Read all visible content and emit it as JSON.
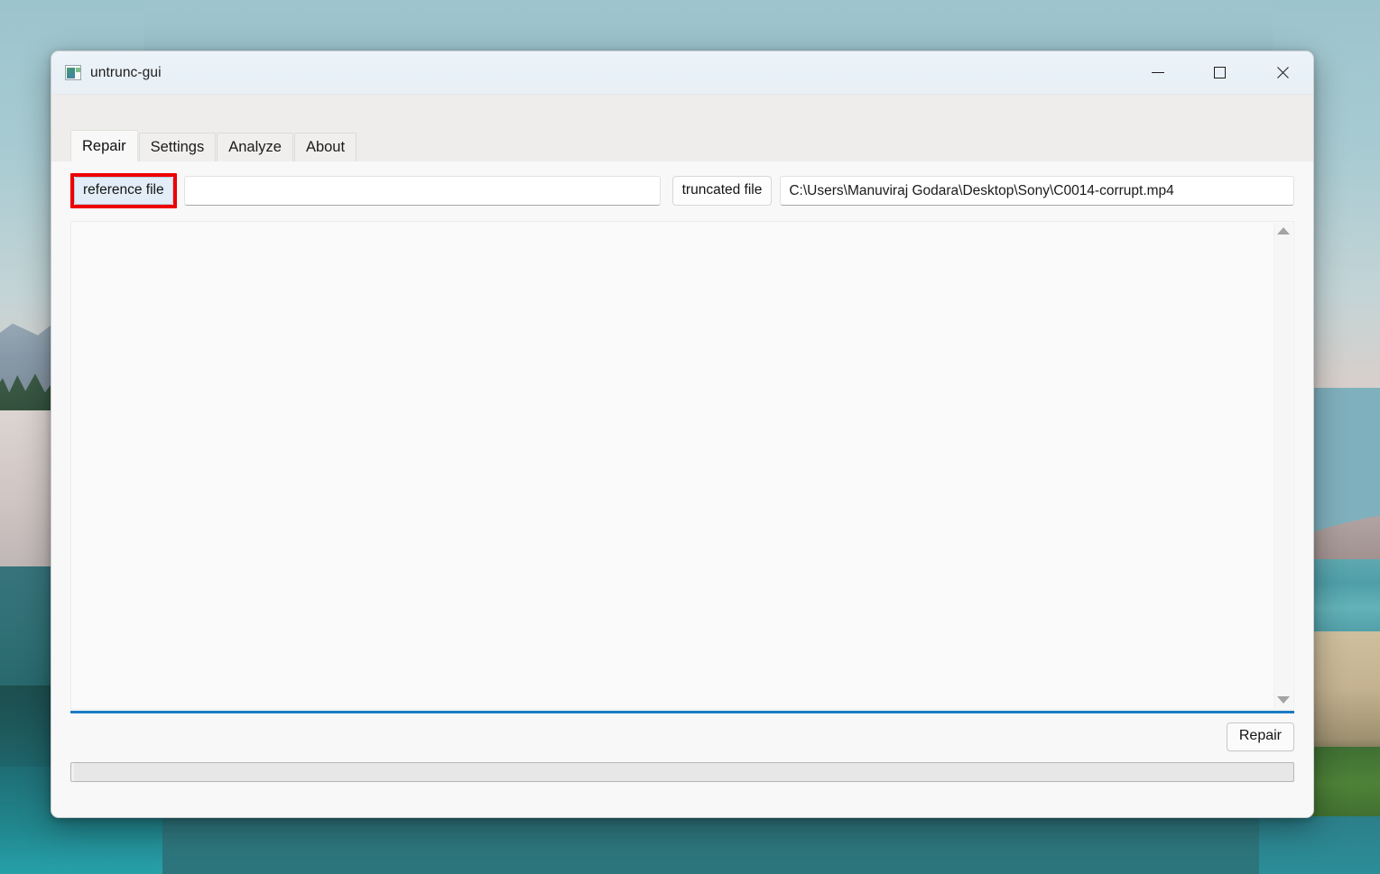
{
  "window": {
    "title": "untrunc-gui",
    "icon": "app-thumbnail-icon",
    "controls": {
      "minimize": "—",
      "maximize": "□",
      "close": "✕"
    }
  },
  "tabs": [
    {
      "label": "Repair",
      "active": true
    },
    {
      "label": "Settings",
      "active": false
    },
    {
      "label": "Analyze",
      "active": false
    },
    {
      "label": "About",
      "active": false
    }
  ],
  "repair_tab": {
    "reference_file": {
      "button_label": "reference file",
      "value": "",
      "placeholder": "",
      "highlighted": true,
      "highlight_color": "#ee0000"
    },
    "truncated_file": {
      "button_label": "truncated file",
      "value": "C:\\Users\\Manuviraj Godara\\Desktop\\Sony\\C0014-corrupt.mp4",
      "placeholder": ""
    },
    "log": {
      "text": "",
      "scrollbar": {
        "up_arrow": "scroll-up-arrow-icon",
        "down_arrow": "scroll-down-arrow-icon"
      },
      "focus_accent_color": "#1a7bc4"
    },
    "repair_button_label": "Repair",
    "progress": {
      "percent": 0,
      "label": ""
    }
  }
}
